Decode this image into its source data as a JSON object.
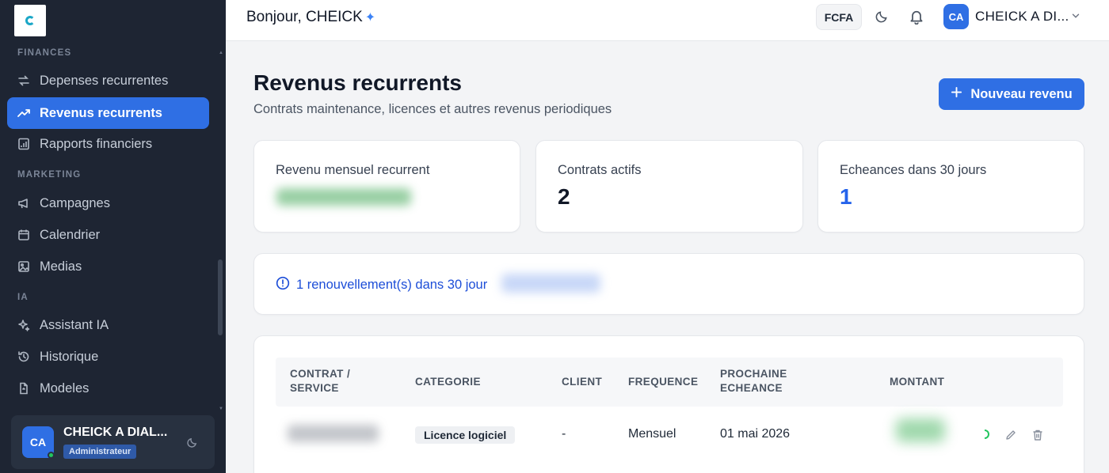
{
  "sidebar": {
    "sections": [
      {
        "title": "FINANCES"
      },
      {
        "title": "MARKETING"
      },
      {
        "title": "IA"
      }
    ],
    "items": [
      {
        "label": "Depenses recurrentes",
        "icon": "repeat-icon"
      },
      {
        "label": "Revenus recurrents",
        "icon": "trending-up-icon",
        "active": true
      },
      {
        "label": "Rapports financiers",
        "icon": "report-icon"
      },
      {
        "label": "Campagnes",
        "icon": "megaphone-icon"
      },
      {
        "label": "Calendrier",
        "icon": "calendar-icon"
      },
      {
        "label": "Medias",
        "icon": "image-icon"
      },
      {
        "label": "Assistant IA",
        "icon": "sparkles-icon"
      },
      {
        "label": "Historique",
        "icon": "history-icon"
      },
      {
        "label": "Modeles",
        "icon": "template-icon"
      }
    ],
    "user": {
      "initials": "CA",
      "name": "CHEICK A DIAL...",
      "role": "Administrateur"
    }
  },
  "topbar": {
    "greeting": "Bonjour, CHEICK",
    "currency": "FCFA",
    "user_initials": "CA",
    "user_name": "CHEICK A DI..."
  },
  "page": {
    "title": "Revenus recurrents",
    "subtitle": "Contrats maintenance, licences et autres revenus periodiques",
    "new_button": "Nouveau revenu"
  },
  "stats": [
    {
      "label": "Revenu mensuel recurrent",
      "value": ""
    },
    {
      "label": "Contrats actifs",
      "value": "2"
    },
    {
      "label": "Echeances dans 30 jours",
      "value": "1"
    }
  ],
  "alert": {
    "text": "1 renouvellement(s) dans 30 jour"
  },
  "table": {
    "headers": {
      "contract": [
        "CONTRAT /",
        "SERVICE"
      ],
      "category": "CATEGORIE",
      "client": "CLIENT",
      "frequency": "FREQUENCE",
      "next_due": [
        "PROCHAINE",
        "ECHEANCE"
      ],
      "amount": "MONTANT"
    },
    "rows": [
      {
        "contract": "",
        "category": "Licence logiciel",
        "client": "-",
        "frequency": "Mensuel",
        "next_due": "01 mai 2026",
        "amount": ""
      }
    ]
  },
  "colors": {
    "sidebar_bg": "#1e2533",
    "accent": "#2f6fe4",
    "alert_blue": "#1d4ed8",
    "online": "#22c55e"
  }
}
